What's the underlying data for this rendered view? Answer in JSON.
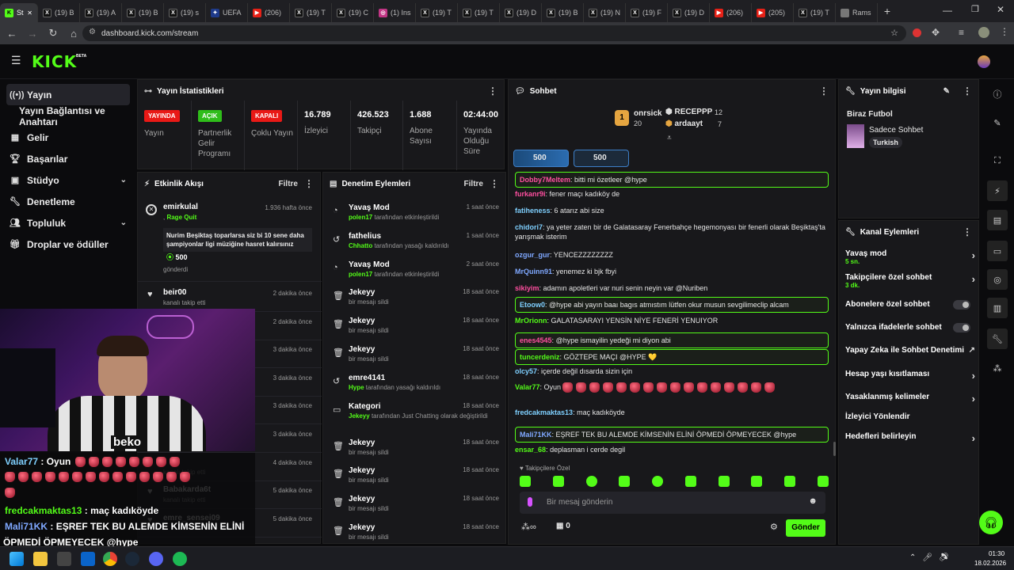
{
  "browser": {
    "tabs": [
      {
        "label": "St",
        "icon": "kick-icon",
        "active": true
      },
      {
        "label": "(19) B",
        "icon": "x-icon"
      },
      {
        "label": "(19) A",
        "icon": "x-icon"
      },
      {
        "label": "(19) B",
        "icon": "x-icon"
      },
      {
        "label": "(19) s",
        "icon": "x-icon"
      },
      {
        "label": "UEFA",
        "icon": "uefa-icon"
      },
      {
        "label": "(206)",
        "icon": "youtube-icon"
      },
      {
        "label": "(19) T",
        "icon": "x-icon"
      },
      {
        "label": "(19) C",
        "icon": "x-icon"
      },
      {
        "label": "(1) Ins",
        "icon": "instagram-icon"
      },
      {
        "label": "(19) T",
        "icon": "x-icon"
      },
      {
        "label": "(19) T",
        "icon": "x-icon"
      },
      {
        "label": "(19) D",
        "icon": "x-icon"
      },
      {
        "label": "(19) B",
        "icon": "x-icon"
      },
      {
        "label": "(19) N",
        "icon": "x-icon"
      },
      {
        "label": "(19) F",
        "icon": "x-icon"
      },
      {
        "label": "(19) D",
        "icon": "x-icon"
      },
      {
        "label": "(206)",
        "icon": "youtube-icon"
      },
      {
        "label": "(205)",
        "icon": "youtube-icon"
      },
      {
        "label": "(19) T",
        "icon": "x-icon"
      },
      {
        "label": "Rams",
        "icon": "page-icon"
      }
    ],
    "url": "dashboard.kick.com/stream"
  },
  "header": {
    "logo": "KICK",
    "beta": "BETA"
  },
  "sidebar": {
    "items": [
      {
        "label": "Yayın",
        "icon": "broadcast-icon"
      },
      {
        "label": "Yayın Bağlantısı ve Anahtarı",
        "icon": ""
      },
      {
        "label": "Gelir",
        "icon": "revenue-icon"
      },
      {
        "label": "Başarılar",
        "icon": "trophy-icon"
      },
      {
        "label": "Stüdyo",
        "icon": "studio-icon"
      },
      {
        "label": "Denetleme",
        "icon": "wrench-icon"
      },
      {
        "label": "Topluluk",
        "icon": "community-icon"
      },
      {
        "label": "Droplar ve ödüller",
        "icon": "gift-icon"
      }
    ]
  },
  "stats": {
    "title": "Yayın İstatistikleri",
    "live_badge": "YAYINDA",
    "live_label": "Yayın",
    "partner_badge": "AÇIK",
    "partner_label": "Partnerlik Gelir Programı",
    "multi_badge": "KAPALI",
    "multi_label": "Çoklu Yayın",
    "viewers_value": "16.789",
    "viewers_label": "İzleyici",
    "followers_value": "426.523",
    "followers_label": "Takipçi",
    "subs_value": "1.688",
    "subs_label": "Abone Sayısı",
    "uptime_value": "02:44:00",
    "uptime_label": "Yayında Olduğu Süre"
  },
  "activity": {
    "title": "Etkinlik Akışı",
    "filter": "Filtre",
    "first": {
      "name": "emirkulal",
      "tag": "Rage Quit",
      "time": "1.936 hafta önce",
      "message": "Nurim Beşiktaş toparlarsa siz bi 10 sene daha şampiyonlar ligi müziğine hasret kalırsınız",
      "amount": "500",
      "sent": "gönderdi"
    },
    "items": [
      {
        "name": "beir00",
        "sub": "kanalı takip etti",
        "time": "2 dakika önce"
      },
      {
        "name": "",
        "sub": "",
        "time": "2 dakika önce"
      },
      {
        "name": "",
        "sub": "",
        "time": "3 dakika önce"
      },
      {
        "name": "",
        "sub": "",
        "time": "3 dakika önce"
      },
      {
        "name": "",
        "sub": "",
        "time": "3 dakika önce"
      },
      {
        "name": "",
        "sub": "",
        "time": "3 dakika önce"
      },
      {
        "name": "",
        "sub": "kanalı takip etti",
        "time": "4 dakika önce"
      },
      {
        "name": "Babakarda6t",
        "sub": "kanalı takip etti",
        "time": "5 dakika önce"
      },
      {
        "name": "emre_sensei09",
        "sub": "",
        "time": "5 dakika önce"
      }
    ]
  },
  "moderation": {
    "title": "Denetim Eylemleri",
    "filter": "Filtre",
    "items": [
      {
        "icon": "slow-icon",
        "title": "Yavaş Mod",
        "by": "polen17",
        "sub": "tarafından etkinleştirildi",
        "time": "1 saat önce"
      },
      {
        "icon": "unban-icon",
        "title": "fathelius",
        "by": "Chhatto",
        "sub": "tarafından yasağı kaldırıldı",
        "time": "1 saat önce"
      },
      {
        "icon": "slow-icon",
        "title": "Yavaş Mod",
        "by": "polen17",
        "sub": "tarafından etkinleştirildi",
        "time": "2 saat önce"
      },
      {
        "icon": "trash-icon",
        "title": "Jekeyy",
        "by": "",
        "sub": "bir mesajı sildi",
        "time": "18 saat önce"
      },
      {
        "icon": "trash-icon",
        "title": "Jekeyy",
        "by": "",
        "sub": "bir mesajı sildi",
        "time": "18 saat önce"
      },
      {
        "icon": "trash-icon",
        "title": "Jekeyy",
        "by": "",
        "sub": "bir mesajı sildi",
        "time": "18 saat önce"
      },
      {
        "icon": "unban-icon",
        "title": "emre4141",
        "by": "Hype",
        "sub": "tarafından yasağı kaldırıldı",
        "time": "18 saat önce"
      },
      {
        "icon": "category-icon",
        "title": "Kategori",
        "by": "Jekeyy",
        "sub": "tarafından Just Chatting olarak değiştirildi",
        "time": "18 saat önce"
      },
      {
        "icon": "trash-icon",
        "title": "Jekeyy",
        "by": "",
        "sub": "bir mesajı sildi",
        "time": "18 saat önce"
      },
      {
        "icon": "trash-icon",
        "title": "Jekeyy",
        "by": "",
        "sub": "bir mesajı sildi",
        "time": "18 saat önce"
      },
      {
        "icon": "trash-icon",
        "title": "Jekeyy",
        "by": "",
        "sub": "bir mesajı sildi",
        "time": "18 saat önce"
      },
      {
        "icon": "trash-icon",
        "title": "Jekeyy",
        "by": "",
        "sub": "bir mesajı sildi",
        "time": "18 saat önce"
      }
    ]
  },
  "chat": {
    "title": "Sohbet",
    "leader_rank": "1",
    "leader1_name": "onrsick",
    "leader1_value": "20",
    "leader2_name": "RECEPPP",
    "leader2_value": "12",
    "leader3_name": "ardaayt",
    "leader3_value": "7",
    "gift1": "500",
    "gift2": "500",
    "messages": [
      {
        "user": "Dobby7Meltem",
        "color": "#ff4fa0",
        "text": "bitti mi özetleer @hype",
        "hl": true
      },
      {
        "user": "furkanr9i",
        "color": "#ff4fa0",
        "text": "fener maçı kadıköy de",
        "hl": false
      },
      {
        "user": "fatiheness",
        "color": "#7fd0ff",
        "text": "6 atarız abi size",
        "hl": false
      },
      {
        "user": "chidori7",
        "color": "#7fd0ff",
        "text": "ya yeter zaten bir de Galatasaray Fenerbahçe hegemonyası bir fenerli olarak Beşiktaş'ta yarışmak isterim",
        "hl": false
      },
      {
        "user": "ozgur_gur",
        "color": "#7fa8ff",
        "text": "YENCEZZZZZZZZ",
        "hl": false
      },
      {
        "user": "MrQuinn91",
        "color": "#7fa8ff",
        "text": "yenemez ki bjk fbyi",
        "hl": false
      },
      {
        "user": "sikiyim",
        "color": "#ff4fa0",
        "text": "adamın apoletleri var nuri senin neyin var @Nuriben",
        "hl": false
      },
      {
        "user": "Etoow0",
        "color": "#7fd0ff",
        "text": "@hype abi yayın baaı bagıs atmıstım lütfen okur musun sevgilimeclip alcam",
        "hl": true
      },
      {
        "user": "MrOrionn",
        "color": "#53fc18",
        "text": "GALATASARAYI YENSİN NİYE FENERİ YENUIYOR",
        "hl": false
      },
      {
        "user": "enes4545",
        "color": "#ff4fa0",
        "text": "@hype ismayilin yedeği mi diyon abi",
        "hl": true
      },
      {
        "user": "tuncerdeniz",
        "color": "#53fc18",
        "text": "GÖZTEPE MAÇI @HYPE 💛",
        "hl": true
      },
      {
        "user": "olcy57",
        "color": "#7fd0ff",
        "text": "içerde değil dısarda sizin için",
        "hl": false
      },
      {
        "user": "Valar77",
        "color": "#53fc18",
        "text": "Oyun",
        "hl": false
      },
      {
        "user": "fredcakmaktas13",
        "color": "#7fd0ff",
        "text": "maç kadıköyde",
        "hl": false
      },
      {
        "user": "Mali71KK",
        "color": "#7fa8ff",
        "text": "EŞREF TEK BU ALEMDE KİMSENİN ELİNİ ÖPMEDİ ÖPMEYECEK @hype",
        "hl": true
      },
      {
        "user": "ensar_68",
        "color": "#53fc18",
        "text": "deplasman i cerde degil",
        "hl": false
      }
    ],
    "followers_only": "Takipçilere Özel",
    "input_placeholder": "Bir mesaj gönderin",
    "count": "0",
    "send": "Gönder"
  },
  "info": {
    "title": "Yayın bilgisi",
    "stream_title": "Biraz Futbol",
    "category": "Sadece Sohbet",
    "tag": "Turkish"
  },
  "channel_actions": {
    "title": "Kanal Eylemleri",
    "slow_mode": "Yavaş mod",
    "slow_mode_sub": "5 sn.",
    "followers_chat": "Takipçilere özel sohbet",
    "followers_chat_sub": "3 dk.",
    "subs_chat": "Abonelere özel sohbet",
    "emote_chat": "Yalnızca ifadelerle sohbet",
    "ai_mod": "Yapay Zeka ile Sohbet Denetimi",
    "age_limit": "Hesap yaşı kısıtlaması",
    "banned_words": "Yasaklanmış kelimeler",
    "redirect": "İzleyici Yönlendir",
    "goals": "Hedefleri belirleyin"
  },
  "overlay": {
    "line1_user": "Valar77",
    "line1_text": "Oyun",
    "line2_user": "fredcakmaktas13",
    "line2_text": "maç kadıköyde",
    "line3_user": "Mali71KK",
    "line3_text": "EŞREF TEK BU ALEMDE KİMSENİN ELİNİ",
    "line4_text": "ÖPMEDİ ÖPMEYECEK @hype",
    "shirt_text": "beko"
  },
  "taskbar": {
    "time": "01:30",
    "date": "18.02.2026"
  },
  "colors": {
    "accent": "#53fc18",
    "live": "#e91916",
    "panel": "#18181b"
  }
}
